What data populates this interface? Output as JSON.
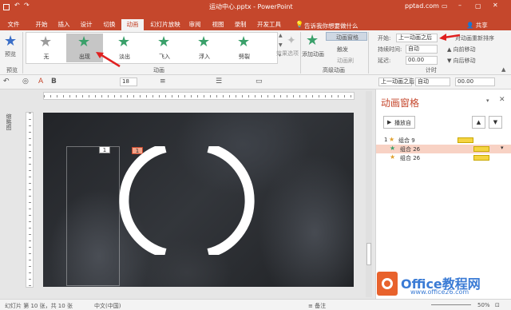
{
  "window": {
    "title": "运动中心.pptx  -  PowerPoint",
    "user": "pptad.com",
    "share": "共享",
    "search_hint": "告诉我你想要做什么"
  },
  "tabs": [
    "文件",
    "开始",
    "插入",
    "设计",
    "切换",
    "动画",
    "幻灯片放映",
    "审阅",
    "视图",
    "录制",
    "开发工具"
  ],
  "ribbon": {
    "preview_label": "预览",
    "preview_group": "预览",
    "animation_group": "动画",
    "gallery": [
      {
        "label": "无",
        "color": "#9b9b9b"
      },
      {
        "label": "出现",
        "color": "#3aa06a"
      },
      {
        "label": "淡出",
        "color": "#3aa06a"
      },
      {
        "label": "飞入",
        "color": "#3aa06a"
      },
      {
        "label": "浮入",
        "color": "#3aa06a"
      },
      {
        "label": "劈裂",
        "color": "#3aa06a"
      }
    ],
    "effect_options": "效果选项",
    "add_animation": "添加动画",
    "anim_pane": "动画窗格",
    "trigger": "触发",
    "anim_painter": "动画刷",
    "advanced_group": "高级动画",
    "start_label": "开始:",
    "start_value": "上一动画之后",
    "duration_label": "持续时间:",
    "duration_value": "自动",
    "delay_label": "延迟:",
    "delay_value": "00.00",
    "reorder": "对动画重新排序",
    "move_earlier": "向前移动",
    "move_later": "向后移动",
    "timing_group": "计时"
  },
  "qbar": {
    "font_size": "18",
    "start_value": "上一动画之后",
    "duration_value": "自动",
    "delay_value": "00.00"
  },
  "pane": {
    "title": "动画窗格",
    "play_from": "播放自",
    "items": [
      {
        "num": "1",
        "label": "组合 9",
        "selected": false
      },
      {
        "num": "",
        "label": "组合 26",
        "selected": true
      },
      {
        "num": "",
        "label": "组合 26",
        "selected": false
      }
    ]
  },
  "slide": {
    "badge1": "1",
    "badge2": "1"
  },
  "sidebar_label": "缩略图",
  "status": {
    "slide_info": "幻灯片 第 10 张，共 10 张",
    "language": "中文(中国)",
    "notes": "备注",
    "zoom": "50%"
  },
  "watermark": {
    "brand": "Office教程网",
    "url": "www.office26.com"
  },
  "colors": {
    "accent": "#c5472c",
    "green": "#3aa06a",
    "yellow": "#f5d442"
  }
}
